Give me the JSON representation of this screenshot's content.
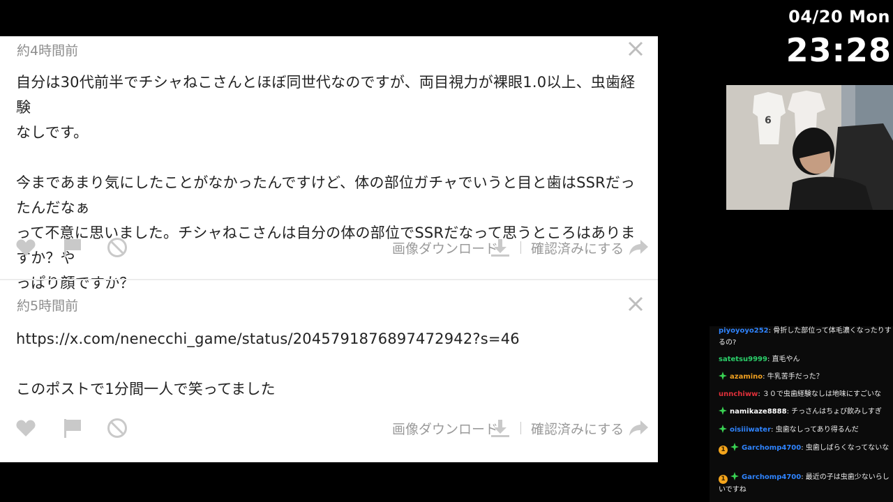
{
  "overlay": {
    "date": "04/20 Mon",
    "time": "23:28"
  },
  "messages": [
    {
      "time": "約4時間前",
      "body": [
        "自分は30代前半でチシャねこさんとほぼ同世代なのですが、両目視力が裸眼1.0以上、虫歯経験",
        "なしです。",
        "",
        "今まであまり気にしたことがなかったんですけど、体の部位ガチャでいうと目と歯はSSRだったんだなぁ",
        "って不意に思いました。チシャねこさんは自分の体の部位でSSRだなって思うところはありますか？や",
        "っぱり顔ですか？"
      ],
      "download_label": "画像ダウンロード",
      "confirm_label": "確認済みにする"
    },
    {
      "time": "約5時間前",
      "body": [
        "https://x.com/nenecchi_game/status/2045791876897472942?s=46",
        "",
        "このポストで1分間一人で笑ってました"
      ],
      "download_label": "画像ダウンロード",
      "confirm_label": "確認済みにする"
    }
  ],
  "chat": [
    {
      "user": "piyoyoyo252",
      "color": "#2f84ff",
      "text": ": 骨折した部位って体毛濃くなったりするの?",
      "badges": []
    },
    {
      "user": "satetsu9999",
      "color": "#2bd06a",
      "text": ": 直毛やん",
      "badges": []
    },
    {
      "user": "azamino",
      "color": "#f0a020",
      "text": ": 牛乳苦手だった？",
      "badges": [
        "star"
      ]
    },
    {
      "user": "unnchiww",
      "color": "#e0303a",
      "text": ": ３０で虫歯経験なしは地味にすごいな",
      "badges": []
    },
    {
      "user": "namikaze8888",
      "color": "#ffffff",
      "text": ": チっさんはちょび飲みしすぎ",
      "badges": [
        "star"
      ]
    },
    {
      "user": "oisiiiwater",
      "color": "#2f84ff",
      "text": ": 虫歯なしってあり得るんだ",
      "badges": [
        "star"
      ]
    },
    {
      "user": "Garchomp4700",
      "color": "#2f84ff",
      "text": ": 虫歯しばらくなってないな",
      "badges": [
        "coin",
        "star"
      ],
      "coin": "1"
    },
    {
      "user": "Garchomp4700",
      "color": "#2f84ff",
      "text": ": 最近の子は虫歯少ないらしいですね",
      "badges": [
        "coin",
        "star"
      ],
      "coin": "1"
    }
  ]
}
